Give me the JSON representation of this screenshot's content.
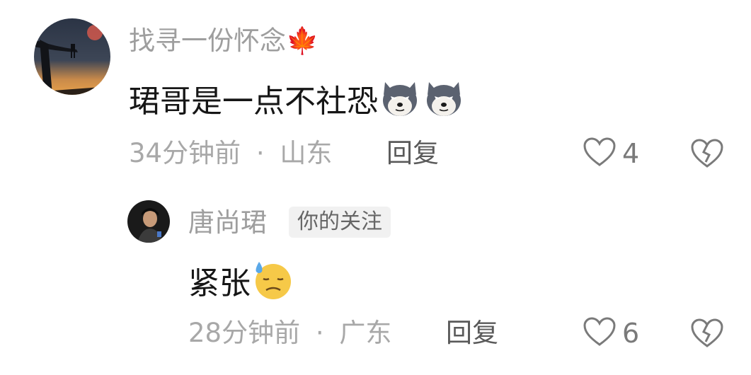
{
  "comments": [
    {
      "username": "找寻一份怀念🍁",
      "text": "珺哥是一点不社恐",
      "emoji": [
        "husky-doge-emoji",
        "husky-doge-emoji"
      ],
      "time": "34分钟前",
      "separator": "·",
      "location": "山东",
      "reply_label": "回复",
      "likes": "4",
      "icons": {
        "like": "heart-outline-icon",
        "dislike": "broken-heart-icon"
      }
    },
    {
      "username": "唐尚珺",
      "badge": "你的关注",
      "text": "紧张",
      "emoji": [
        "sweat-face-emoji"
      ],
      "time": "28分钟前",
      "separator": "·",
      "location": "广东",
      "reply_label": "回复",
      "likes": "6",
      "icons": {
        "like": "heart-outline-icon",
        "dislike": "broken-heart-icon"
      }
    }
  ]
}
